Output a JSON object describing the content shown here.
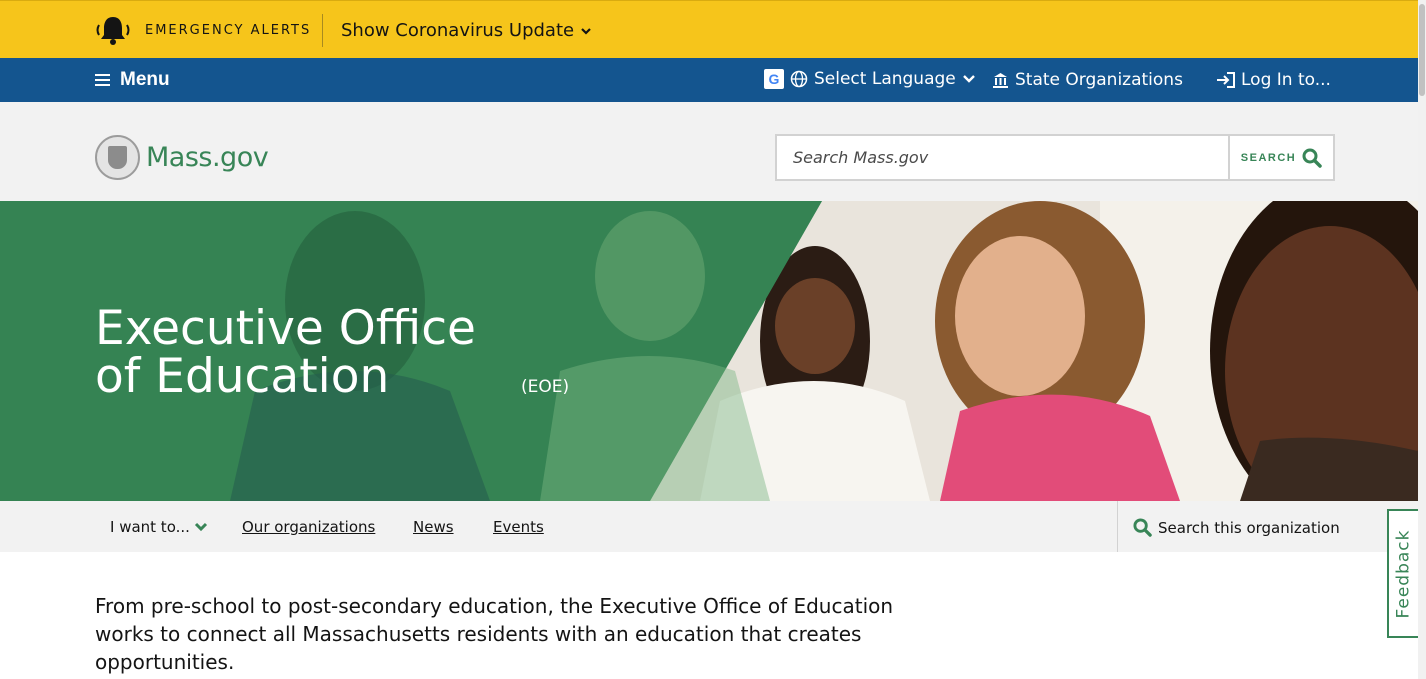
{
  "alerts": {
    "label": "EMERGENCY ALERTS",
    "toggle_label": "Show Coronavirus Update",
    "bell_icon": "bell-icon"
  },
  "utility_nav": {
    "menu_label": "Menu",
    "language_label": "Select Language",
    "state_orgs_label": "State Organizations",
    "login_label": "Log In to..."
  },
  "header": {
    "logo_text": "Mass.gov",
    "search_placeholder": "Search Mass.gov",
    "search_button_label": "SEARCH"
  },
  "hero": {
    "title": "Executive Office of Education",
    "abbreviation": "(EOE)"
  },
  "org_nav": {
    "i_want_to": "I want to...",
    "links": [
      "Our organizations",
      "News",
      "Events"
    ],
    "search_org_label": "Search this organization"
  },
  "intro_text": "From pre-school to post-secondary education, the Executive Office of Education works to connect all Massachusetts residents with an education that creates opportunities.",
  "feedback_label": "Feedback",
  "colors": {
    "alert_yellow": "#f6c51b",
    "nav_blue": "#14558f",
    "brand_green": "#388557",
    "header_gray": "#f2f2f2"
  }
}
